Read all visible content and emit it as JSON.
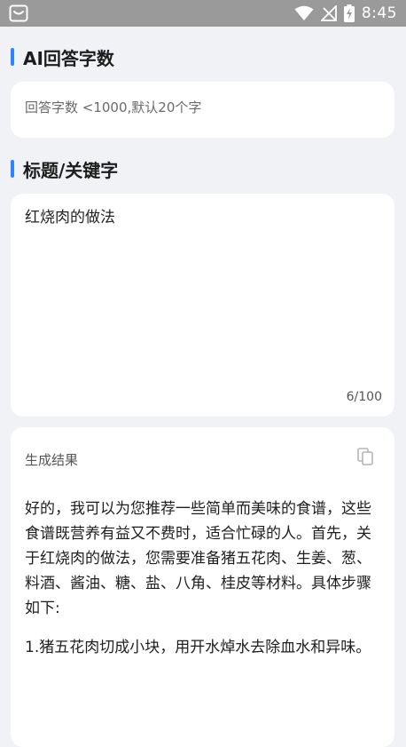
{
  "status_bar": {
    "time": "8:45",
    "icons": [
      "notification-icon",
      "wifi-icon",
      "no-signal-icon",
      "battery-charging-icon"
    ]
  },
  "sections": {
    "ai_word_count": {
      "title": "AI回答字数",
      "input_placeholder": "回答字数 <1000,默认20个字",
      "input_value": ""
    },
    "keyword": {
      "title": "标题/关键字",
      "input_value": "红烧肉的做法",
      "counter": "6/100"
    },
    "result": {
      "label": "生成结果",
      "copy_icon": "copy-icon",
      "paragraphs": [
        "好的，我可以为您推荐一些简单而美味的食谱，这些食谱既营养有益又不费时，适合忙碌的人。首先，关于红烧肉的做法，您需要准备猪五花肉、生姜、葱、料酒、酱油、糖、盐、八角、桂皮等材料。具体步骤如下:",
        "1.猪五花肉切成小块，用开水焯水去除血水和异味。"
      ]
    }
  },
  "colors": {
    "accent": "#2b86ff",
    "background": "#f1f2f6",
    "card": "#ffffff",
    "status_bar": "#9a9a9a"
  }
}
